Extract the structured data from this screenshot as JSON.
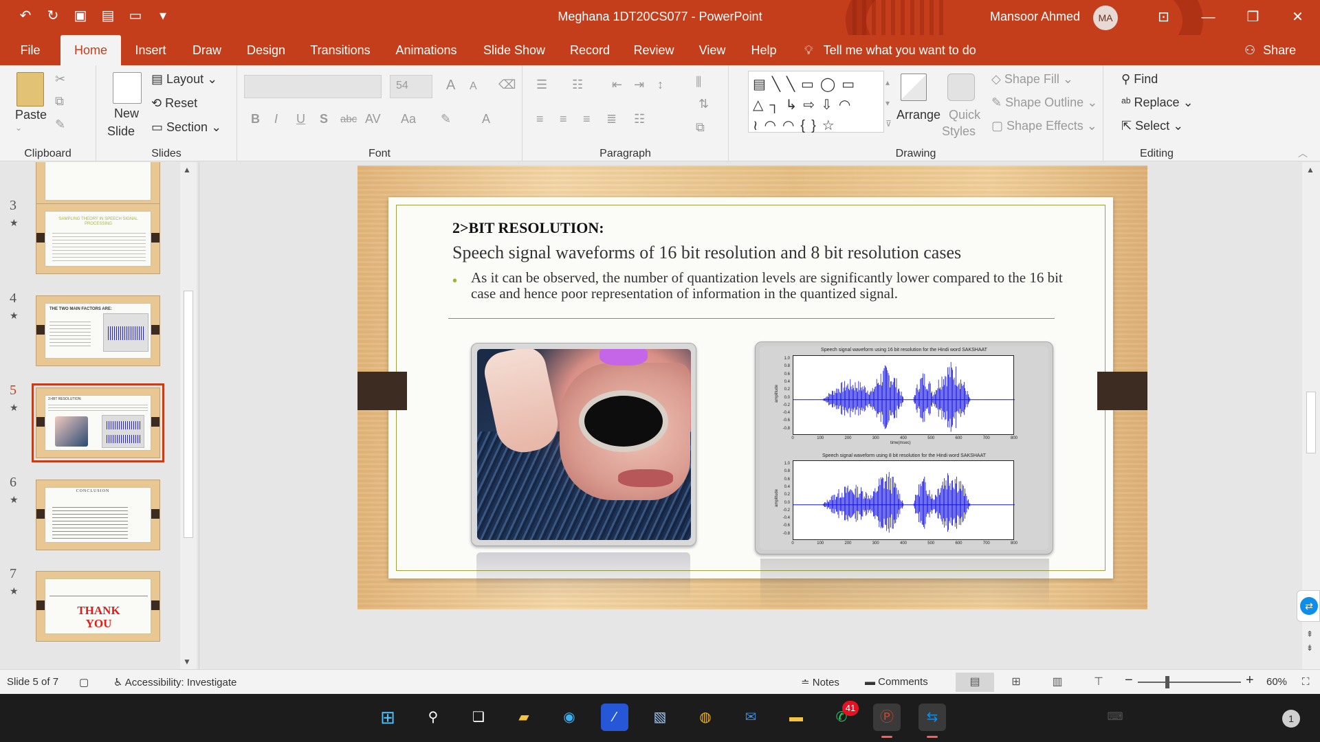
{
  "app": {
    "title": "Meghana 1DT20CS077  -  PowerPoint",
    "user_name": "Mansoor Ahmed",
    "user_initials": "MA"
  },
  "tabs": [
    "File",
    "Home",
    "Insert",
    "Draw",
    "Design",
    "Transitions",
    "Animations",
    "Slide Show",
    "Record",
    "Review",
    "View",
    "Help"
  ],
  "active_tab": "Home",
  "tell_me": "Tell me what you want to do",
  "share_label": "Share",
  "ribbon": {
    "clipboard": {
      "paste": "Paste",
      "label": "Clipboard"
    },
    "slides": {
      "new_slide_1": "New",
      "new_slide_2": "Slide",
      "layout": "Layout",
      "reset": "Reset",
      "section": "Section",
      "label": "Slides"
    },
    "font": {
      "size": "54",
      "label": "Font",
      "bold": "B",
      "italic": "I",
      "underline": "U",
      "shadow": "S",
      "strike": "abc",
      "spacing": "AV",
      "case": "Aa",
      "grow": "A",
      "shrink": "A",
      "color": "A"
    },
    "paragraph": {
      "label": "Paragraph"
    },
    "drawing": {
      "arrange": "Arrange",
      "quick_styles_1": "Quick",
      "quick_styles_2": "Styles",
      "shape_fill": "Shape Fill",
      "shape_outline": "Shape Outline",
      "shape_effects": "Shape Effects",
      "label": "Drawing"
    },
    "editing": {
      "find": "Find",
      "replace": "Replace",
      "select": "Select",
      "label": "Editing"
    }
  },
  "thumbnails": [
    {
      "number": "3",
      "title": "SAMPLING THEORY IN SPEECH SIGNAL PROCESSING"
    },
    {
      "number": "4",
      "title": "THE TWO MAIN FACTORS ARE:"
    },
    {
      "number": "5",
      "title": "2>BIT RESOLUTION:"
    },
    {
      "number": "6",
      "title": "CONCLUSION"
    },
    {
      "number": "7",
      "title": "THANK YOU"
    }
  ],
  "slide": {
    "heading": "2>BIT RESOLUTION:",
    "subtitle": "Speech signal waveforms of  16 bit resolution and 8 bit resolution cases",
    "bullet": "As it can be observed, the number of quantization levels are significantly lower compared to the 16 bit case and hence poor representation of information in the quantized signal.",
    "plot1_title": "Speech signal waveform using 16 bit resolution for the Hindi word SAKSHAAT",
    "plot2_title": "Speech signal waveform using 8 bit resolution for the Hindi word SAKSHAAT",
    "ylabel": "amplitude",
    "xlabel": "time(msec)",
    "yticks": [
      "1.0",
      "0.8",
      "0.6",
      "0.4",
      "0.2",
      "0.0",
      "-0.2",
      "-0.4",
      "-0.6",
      "-0.8"
    ],
    "xticks": [
      "0",
      "100",
      "200",
      "300",
      "400",
      "500",
      "600",
      "700",
      "800"
    ]
  },
  "status": {
    "slide_of": "Slide 5 of 7",
    "accessibility": "Accessibility: Investigate",
    "notes": "Notes",
    "comments": "Comments",
    "zoom": "60%"
  },
  "taskbar": {
    "whatsapp_badge": "41",
    "notifications": "1"
  },
  "colors": {
    "accent": "#c43e1c",
    "waveform": "#1010e0"
  }
}
